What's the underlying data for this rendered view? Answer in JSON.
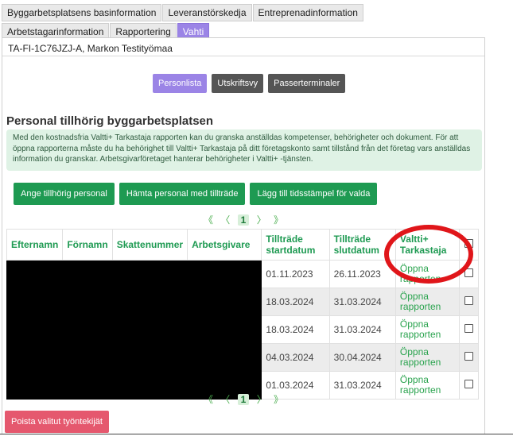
{
  "tabs": [
    {
      "label": "Byggarbetsplatsens basinformation",
      "active": false
    },
    {
      "label": "Leveranstörskedja",
      "active": false
    },
    {
      "label": "Entreprenadinformation",
      "active": false
    },
    {
      "label": "Arbetstagarinformation",
      "active": false
    },
    {
      "label": "Rapportering",
      "active": false
    },
    {
      "label": "Vahti",
      "active": true
    }
  ],
  "site_title": "TA-FI-1C76JZJ-A, Markon Testityömaa",
  "view_buttons": {
    "personlista": "Personlista",
    "utskriftsvy": "Utskriftsvy",
    "passerterminaler": "Passerterminaler"
  },
  "section_title": "Personal tillhörig byggarbetsplatsen",
  "info_text": "Med den kostnadsfria Valtti+ Tarkastaja rapporten kan du granska anställdas kompetenser, behörigheter och dokument. För att öppna rapporterna måste du ha behörighet till Valtti+ Tarkastaja på ditt företagskonto samt tillstånd från det företag vars anställdas information du granskar. Arbetsgivarföretaget hanterar behörigheter i Valtti+ -tjänsten.",
  "actions": {
    "add_personnel": "Ange tillhörig personal",
    "fetch_with_access": "Hämta personal med tillträde",
    "add_timestamp": "Lägg till tidsstämpel för valda"
  },
  "pager": {
    "first": "《",
    "prev": "〈",
    "page": "1",
    "next": "〉",
    "last": "》"
  },
  "columns": {
    "lastname": "Efternamn",
    "firstname": "Förnamn",
    "tax_number": "Skattenummer",
    "employer": "Arbetsgivare",
    "access_start": "Tillträde startdatum",
    "access_end": "Tillträde slutdatum",
    "valtti": "Valtti+ Tarkastaja"
  },
  "rows": [
    {
      "start": "01.11.2023",
      "end": "26.11.2023",
      "report": "Öppna rapporten"
    },
    {
      "start": "18.03.2024",
      "end": "31.03.2024",
      "report": "Öppna rapporten"
    },
    {
      "start": "18.03.2024",
      "end": "31.03.2024",
      "report": "Öppna rapporten"
    },
    {
      "start": "04.03.2024",
      "end": "30.04.2024",
      "report": "Öppna rapporten"
    },
    {
      "start": "01.03.2024",
      "end": "31.03.2024",
      "report": "Öppna rapporten"
    }
  ],
  "delete_button": "Poista valitut työntekijät",
  "colors": {
    "accent_purple": "#9b84e6",
    "green": "#1e9a52",
    "annotation_red": "#e0161a",
    "delete_pink": "#e5586e"
  }
}
